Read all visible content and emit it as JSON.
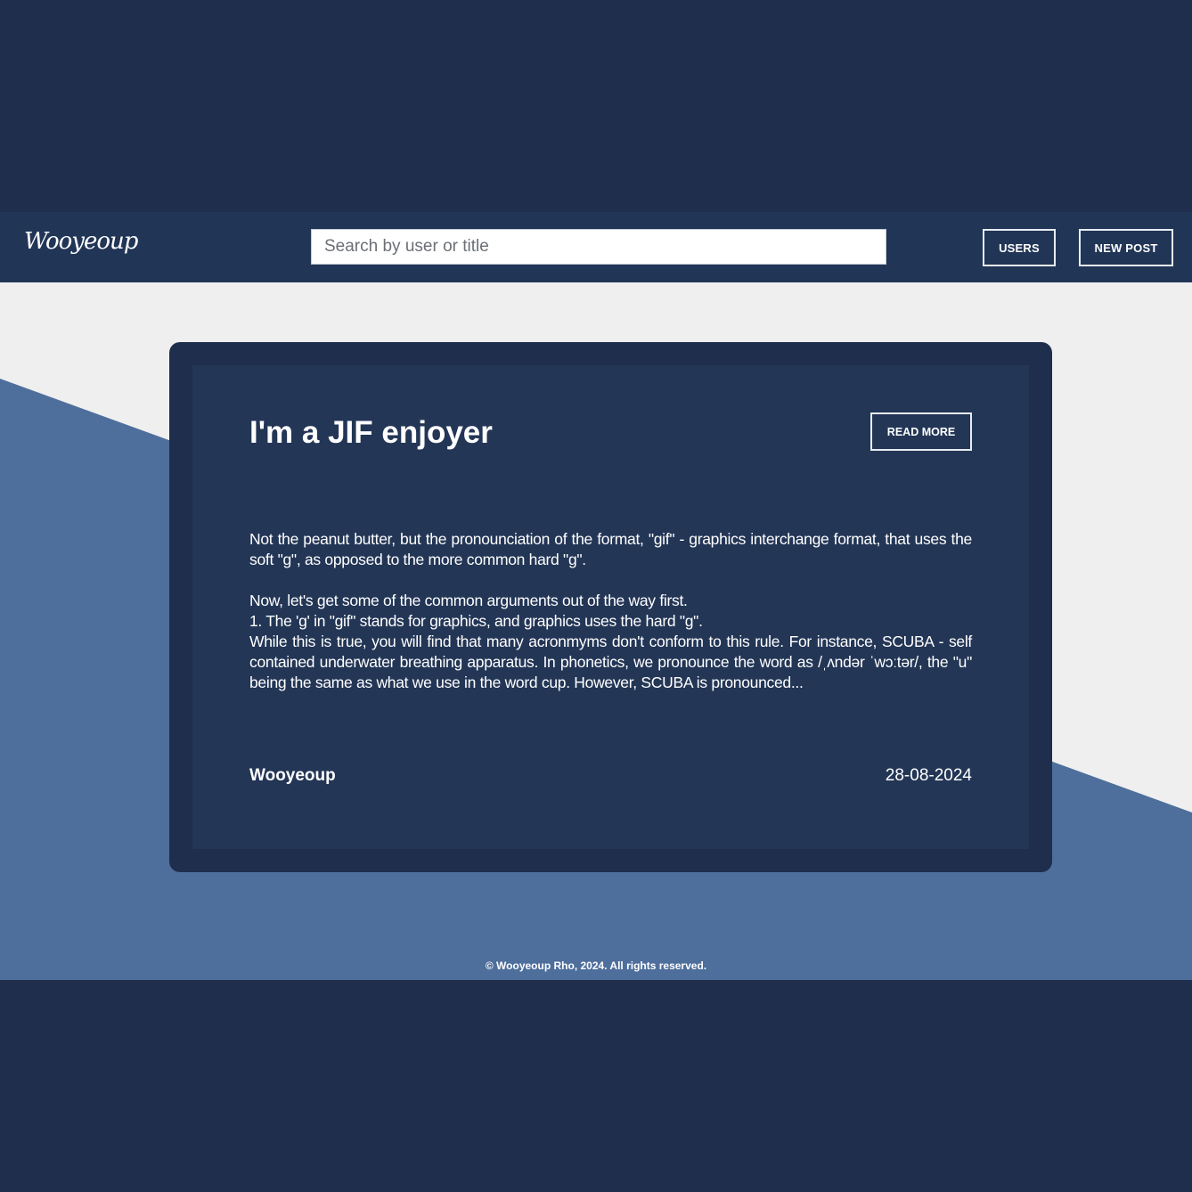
{
  "header": {
    "logo": "Wooyeoup",
    "search_placeholder": "Search by user or title",
    "users_label": "USERS",
    "new_post_label": "NEW POST"
  },
  "post": {
    "title": "I'm a JIF enjoyer",
    "read_more_label": "READ MORE",
    "paragraphs": [
      "Not the peanut butter, but the pronounciation of the format, \"gif\" - graphics interchange format, that uses the soft \"g\", as opposed to the more common hard \"g\".",
      "Now, let's get some of the common arguments out of the way first.",
      "1. The 'g' in \"gif\" stands for graphics, and graphics uses the hard \"g\".",
      "While this is true, you will find that many acronmyms don't conform to this rule. For instance, SCUBA - self contained underwater breathing apparatus. In phonetics, we pronounce the word as /ˌʌndər ˈwɔːtər/, the \"u\" being the same as what we use in the word cup. However, SCUBA is pronounced..."
    ],
    "author": "Wooyeoup",
    "date": "28-08-2024"
  },
  "footer": {
    "copyright": "© Wooyeoup Rho, 2024. All rights reserved."
  },
  "colors": {
    "page_bg": "#1f2e4d",
    "navbar_bg": "#213556",
    "main_bg": "#efefef",
    "accent_stripe": "#4e6e9c",
    "card_outer": "#1f2e4d",
    "card_inner": "#233656"
  }
}
